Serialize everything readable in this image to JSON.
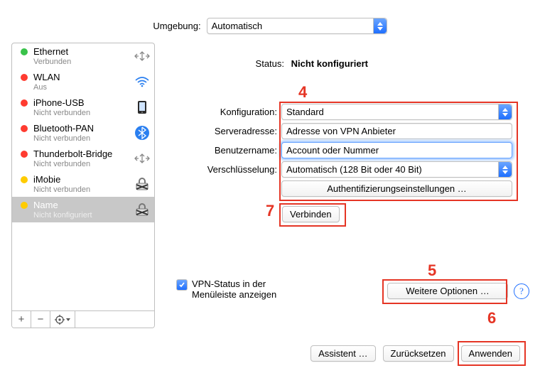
{
  "top": {
    "label": "Umgebung:",
    "select": "Automatisch"
  },
  "sidebar": {
    "items": [
      {
        "name": "Ethernet",
        "sub": "Verbunden",
        "dot": "green"
      },
      {
        "name": "WLAN",
        "sub": "Aus",
        "dot": "red"
      },
      {
        "name": "iPhone-USB",
        "sub": "Nicht verbunden",
        "dot": "red"
      },
      {
        "name": "Bluetooth-PAN",
        "sub": "Nicht verbunden",
        "dot": "red"
      },
      {
        "name": "Thunderbolt-Bridge",
        "sub": "Nicht verbunden",
        "dot": "red"
      },
      {
        "name": "iMobie",
        "sub": "Nicht verbunden",
        "dot": "yellow"
      },
      {
        "name": "Name",
        "sub": "Nicht konfiguriert",
        "dot": "yellow"
      }
    ],
    "btns": {
      "add": "+",
      "remove": "−",
      "gear": "✻▾"
    }
  },
  "status": {
    "label": "Status:",
    "value": "Nicht konfiguriert"
  },
  "form": {
    "config_label": "Konfiguration:",
    "config_value": "Standard",
    "server_label": "Serveradresse:",
    "server_value": "Adresse von VPN Anbieter",
    "user_label": "Benutzername:",
    "user_value": "Account oder Nummer",
    "enc_label": "Verschlüsselung:",
    "enc_value": "Automatisch (128 Bit oder 40 Bit)",
    "auth_btn": "Authentifizierungseinstellungen …",
    "connect_btn": "Verbinden"
  },
  "vpn_check": {
    "line1": "VPN-Status in der",
    "line2": "Menüleiste anzeigen"
  },
  "more": {
    "label": "Weitere Optionen …"
  },
  "bottom": {
    "assist": "Assistent …",
    "revert": "Zurücksetzen",
    "apply": "Anwenden"
  },
  "annotations": {
    "n4": "4",
    "n5": "5",
    "n6": "6",
    "n7": "7"
  }
}
